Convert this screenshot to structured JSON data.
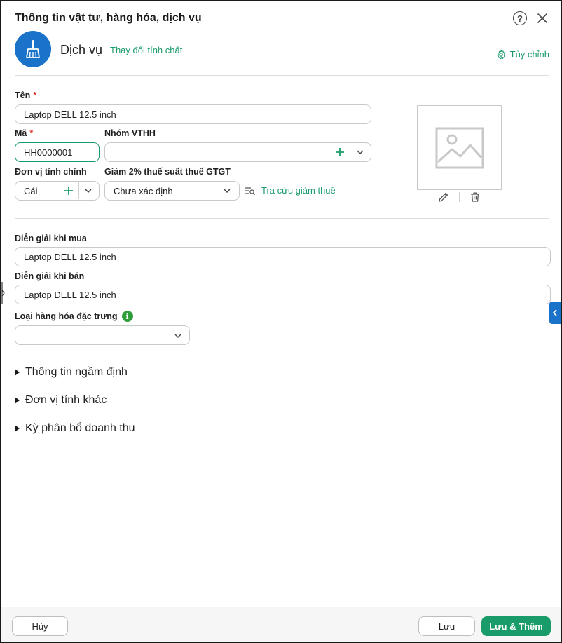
{
  "header": {
    "title": "Thông tin vật tư, hàng hóa, dịch vụ"
  },
  "item_type": {
    "icon": "broom-icon",
    "label": "Dịch vụ",
    "change_link": "Thay đổi tính chất"
  },
  "customize_label": "Tùy chỉnh",
  "form": {
    "name": {
      "label": "Tên",
      "value": "Laptop DELL 12.5 inch"
    },
    "code": {
      "label": "Mã",
      "value": "HH0000001"
    },
    "group": {
      "label": "Nhóm VTHH",
      "value": ""
    },
    "unit": {
      "label": "Đơn vị tính chính",
      "value": "Cái"
    },
    "vat_reduction": {
      "label": "Giảm 2% thuế suất thuế GTGT",
      "value": "Chưa xác định"
    },
    "tax_lookup": "Tra cứu giảm thuế",
    "purchase_desc": {
      "label": "Diễn giải khi mua",
      "value": "Laptop DELL 12.5 inch"
    },
    "sale_desc": {
      "label": "Diễn giải khi bán",
      "value": "Laptop DELL 12.5 inch"
    },
    "special_type": {
      "label": "Loại hàng hóa đặc trưng",
      "value": ""
    }
  },
  "sections": [
    {
      "label": "Thông tin ngầm định"
    },
    {
      "label": "Đơn vị tính khác"
    },
    {
      "label": "Kỳ phân bổ doanh thu"
    }
  ],
  "footer": {
    "cancel": "Hủy",
    "save": "Lưu",
    "save_add": "Lưu & Thêm"
  },
  "colors": {
    "accent": "#1a9c6a",
    "brand_blue": "#1a73c8",
    "required": "#e03a2f"
  }
}
